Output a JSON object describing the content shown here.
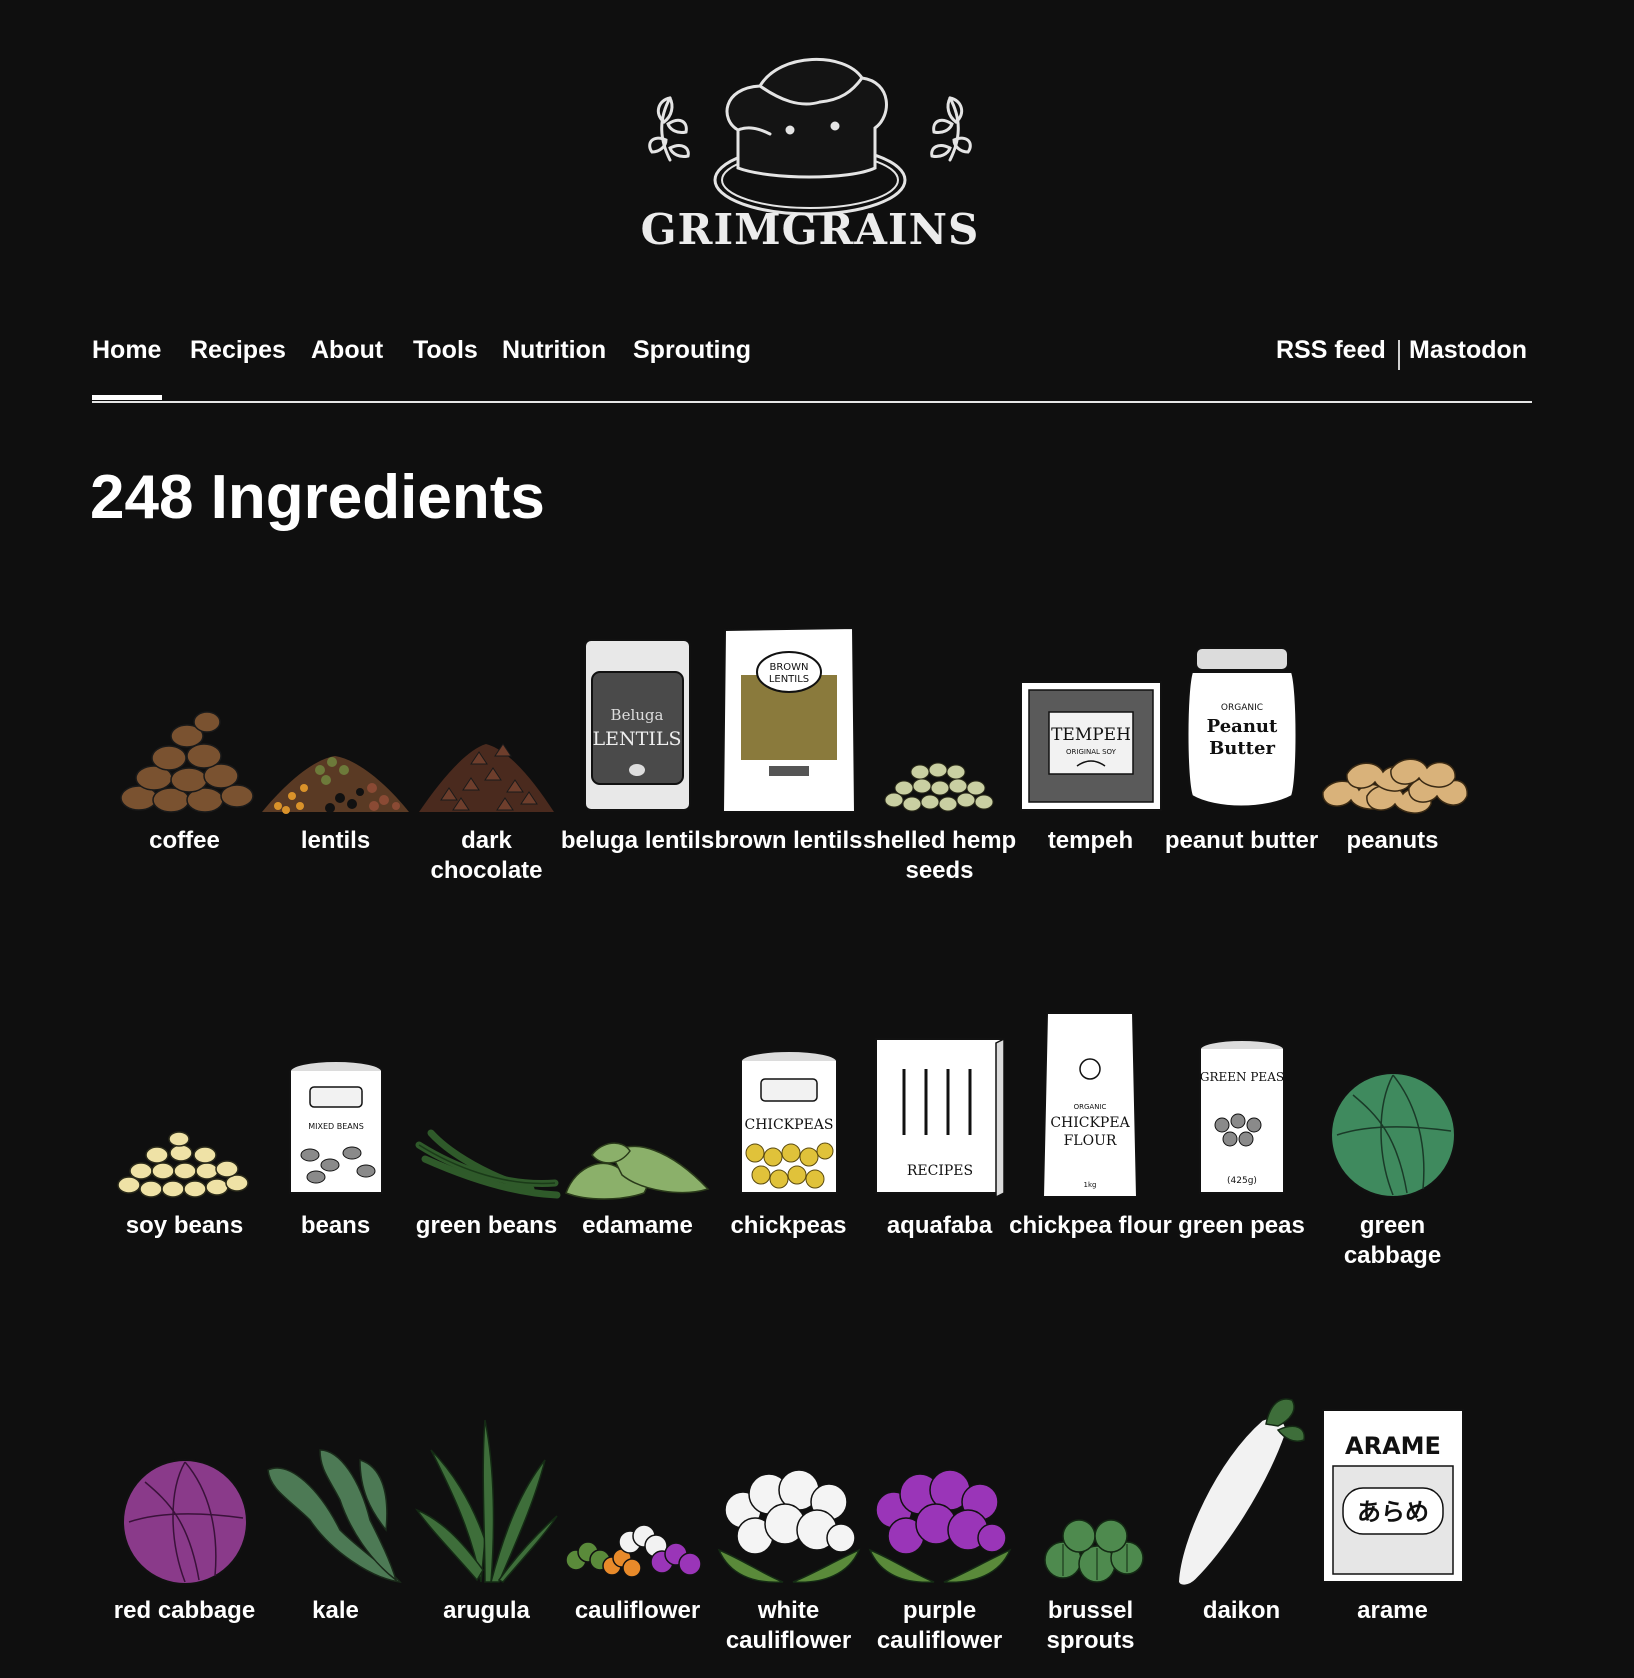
{
  "site": {
    "brand": "GRIMGRAINS",
    "logo_icon": "bread-loaf-with-sprigs"
  },
  "nav": {
    "items": [
      {
        "label": "Home",
        "active": true
      },
      {
        "label": "Recipes",
        "active": false
      },
      {
        "label": "About",
        "active": false
      },
      {
        "label": "Tools",
        "active": false
      },
      {
        "label": "Nutrition",
        "active": false
      },
      {
        "label": "Sprouting",
        "active": false
      }
    ],
    "right": [
      {
        "label": "RSS feed"
      },
      {
        "label": "Mastodon"
      }
    ]
  },
  "page": {
    "title": "248 Ingredients"
  },
  "ingredients": [
    {
      "name": "coffee",
      "icon": "coffee-beans-pile-icon"
    },
    {
      "name": "lentils",
      "icon": "lentils-pile-icon"
    },
    {
      "name": "dark chocolate",
      "icon": "chocolate-chips-pile-icon"
    },
    {
      "name": "beluga lentils",
      "icon": "beluga-lentils-bag-icon",
      "package_text": [
        "Beluga",
        "LENTILS"
      ]
    },
    {
      "name": "brown lentils",
      "icon": "brown-lentils-bag-icon",
      "package_text": [
        "BROWN",
        "LENTILS"
      ]
    },
    {
      "name": "shelled hemp seeds",
      "icon": "hemp-seeds-pile-icon"
    },
    {
      "name": "tempeh",
      "icon": "tempeh-package-icon",
      "package_text": [
        "TEMPEH",
        "ORIGINAL SOY"
      ]
    },
    {
      "name": "peanut butter",
      "icon": "peanut-butter-jar-icon",
      "package_text": [
        "ORGANIC",
        "Peanut",
        "Butter"
      ]
    },
    {
      "name": "peanuts",
      "icon": "peanuts-pile-icon"
    },
    {
      "name": "soy beans",
      "icon": "soy-beans-pile-icon"
    },
    {
      "name": "beans",
      "icon": "mixed-beans-can-icon",
      "package_text": [
        "MIXED BEANS"
      ]
    },
    {
      "name": "green beans",
      "icon": "green-beans-icon"
    },
    {
      "name": "edamame",
      "icon": "edamame-pods-icon"
    },
    {
      "name": "chickpeas",
      "icon": "chickpeas-can-icon",
      "package_text": [
        "CHICKPEAS"
      ]
    },
    {
      "name": "aquafaba",
      "icon": "recipe-book-icon",
      "package_text": [
        "RECIPES"
      ]
    },
    {
      "name": "chickpea flour",
      "icon": "chickpea-flour-bag-icon",
      "package_text": [
        "ORGANIC",
        "CHICKPEA",
        "FLOUR",
        "1kg"
      ]
    },
    {
      "name": "green peas",
      "icon": "green-peas-can-icon",
      "package_text": [
        "GREEN PEAS",
        "(425g)"
      ]
    },
    {
      "name": "green cabbage",
      "icon": "green-cabbage-icon"
    },
    {
      "name": "red cabbage",
      "icon": "red-cabbage-icon"
    },
    {
      "name": "kale",
      "icon": "kale-icon"
    },
    {
      "name": "arugula",
      "icon": "arugula-icon"
    },
    {
      "name": "cauliflower",
      "icon": "mixed-cauliflower-icon"
    },
    {
      "name": "white cauliflower",
      "icon": "white-cauliflower-icon"
    },
    {
      "name": "purple cauliflower",
      "icon": "purple-cauliflower-icon"
    },
    {
      "name": "brussel sprouts",
      "icon": "brussel-sprouts-icon"
    },
    {
      "name": "daikon",
      "icon": "daikon-icon"
    },
    {
      "name": "arame",
      "icon": "arame-bag-icon",
      "package_text": [
        "ARAME",
        "あらめ"
      ]
    }
  ],
  "colors": {
    "background": "#0f0f0f",
    "text": "#ffffff",
    "coffee": "#7a5230",
    "lentils_orange": "#d9922a",
    "lentils_green": "#6d7a3a",
    "chocolate": "#4a2a1e",
    "hemp": "#c9cfa2",
    "peanut": "#d9b27a",
    "soy": "#efe2a6",
    "green_bean": "#2f5a2a",
    "edamame": "#8bb06a",
    "chickpea": "#e0c23a",
    "green_cabbage": "#3f8a5e",
    "red_cabbage": "#8a3a8a",
    "kale": "#4d7a55",
    "arugula": "#3e6e3a",
    "purple_cauliflower": "#9a35b8",
    "brussel": "#4e8a4e"
  }
}
